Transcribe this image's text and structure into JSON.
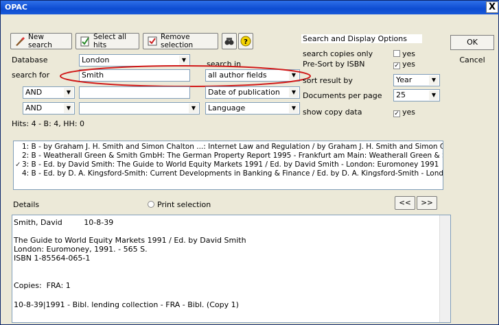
{
  "window": {
    "title": "OPAC",
    "close_glyph": "X"
  },
  "toolbar": {
    "new_search": "New search",
    "select_all": "Select all hits",
    "remove_selection": "Remove selection"
  },
  "form": {
    "database_label": "Database",
    "database_value": "London",
    "search_in_label": "search in",
    "search_for_label": "search for",
    "search_for_value": "Smith",
    "search_in_value": "all author fields",
    "row2_op": "AND",
    "row2_field": "Date of publication",
    "row3_op": "AND",
    "row3_field": "Language",
    "hits": "Hits: 4 - B: 4, HH: 0"
  },
  "options": {
    "title": "Search and Display Options",
    "copies_only_label": "search copies only",
    "copies_only_value": "yes",
    "presort_label": "Pre-Sort by ISBN",
    "presort_value": "yes",
    "sort_label": "sort result by",
    "sort_value": "Year",
    "docs_label": "Documents per page",
    "docs_value": "25",
    "copydata_label": "show copy data",
    "copydata_value": "yes"
  },
  "buttons": {
    "ok": "OK",
    "cancel": "Cancel",
    "prev": "<<",
    "next": ">>"
  },
  "results": [
    "1: B - by Graham J. H. Smith and Simon Chalton ...: Internet Law and Regulation / by Graham J. H. Smith and Simon Chalton",
    "2: B - Weatherall Green & Smith GmbH: The German Property Report 1995 - Frankfurt am Main: Weatherall Green & Smith GmbH",
    "3: B - Ed. by David Smith: The Guide to World Equity Markets 1991 / Ed. by David Smith - London: Euromoney 1991",
    "4: B - Ed. by D. A. Kingsford-Smith: Current Developments in Banking & Finance / Ed. by D. A. Kingsford-Smith - London: Stevens"
  ],
  "details": {
    "label": "Details",
    "print_label": "Print selection",
    "line1": "Smith, David         10-8-39",
    "line2": "The Guide to World Equity Markets 1991 / Ed. by David Smith",
    "line3": "London: Euromoney, 1991. - 565 S.",
    "line4": "ISBN 1-85564-065-1",
    "line5": "Copies:  FRA: 1",
    "line6": "10-8-39|1991 - Bibl. lending collection - FRA - Bibl. (Copy 1)"
  }
}
